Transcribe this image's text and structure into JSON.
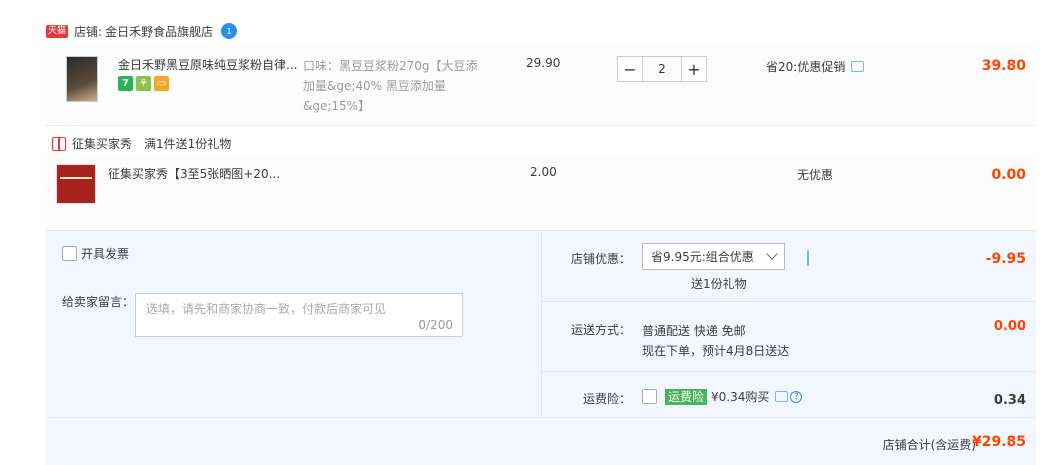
{
  "store": {
    "badge": "天猫",
    "label": "店铺:",
    "name": "金日禾野食品旗舰店",
    "ww_icon": "1"
  },
  "item1": {
    "title": "金日禾野黑豆原味纯豆浆粉自律...",
    "tags": [
      {
        "text": "7",
        "color": "#2bb35a",
        "icon": "seven-day-return-icon"
      },
      {
        "text": "⚘",
        "color": "#8bc34a",
        "icon": "flower-service-icon"
      },
      {
        "text": "▭",
        "color": "#f5a623",
        "icon": "credit-card-icon"
      }
    ],
    "attr": "口味：黑豆豆浆粉270g【大豆添加量&ge;40% 黑豆添加量&ge;15%】",
    "price": "29.90",
    "quantity": "2",
    "promo": "省20:优惠促销",
    "subtotal": "39.80"
  },
  "gift": {
    "label": "征集买家秀",
    "desc": "满1件送1份礼物"
  },
  "item2": {
    "title": "征集买家秀【3至5张晒图+20...",
    "price": "2.00",
    "promo": "无优惠",
    "subtotal": "0.00"
  },
  "invoice": {
    "label": "开具发票"
  },
  "message": {
    "label": "给卖家留言：",
    "placeholder": "选填，请先和商家协商一致，付款后商家可见",
    "count": "0/200"
  },
  "shop_discount": {
    "label": "店铺优惠：",
    "selected": "省9.95元:组合优惠",
    "note": "送1份礼物",
    "amount": "-9.95"
  },
  "shipping": {
    "label": "运送方式：",
    "method": "普通配送 快递 免邮",
    "eta": "现在下单，预计4月8日送达",
    "amount": "0.00"
  },
  "insurance": {
    "label": "运费险：",
    "badge": "运费险",
    "price": "¥0.34购买",
    "help": "?",
    "amount": "0.34"
  },
  "total": {
    "label": "店铺合计(含运费)",
    "amount": "¥29.85"
  },
  "colors": {
    "accent": "#ff4400",
    "bottom_bg": "#f2f7ff",
    "insurance_green": "#4bb45a"
  }
}
